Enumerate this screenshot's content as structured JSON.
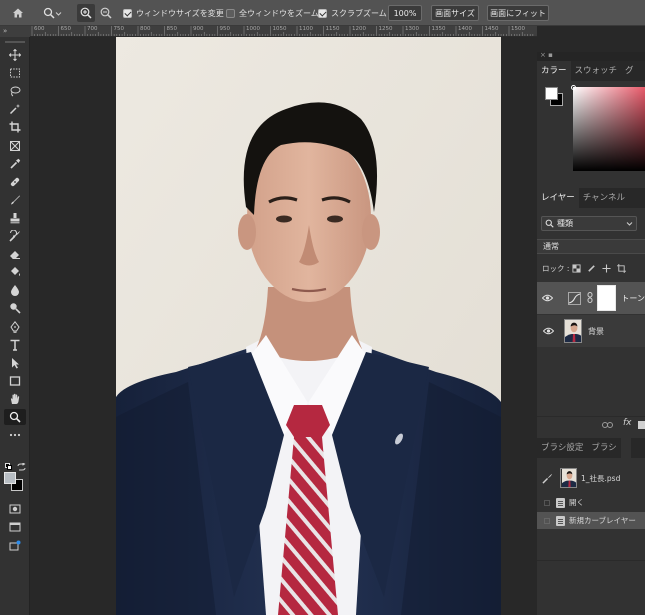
{
  "options_bar": {
    "checkbox_resize_window": {
      "label": "ウィンドウサイズを変更",
      "checked": true
    },
    "checkbox_zoom_all": {
      "label": "全ウィンドウをズーム",
      "checked": false
    },
    "checkbox_scrubby_zoom": {
      "label": "スクラブズーム",
      "checked": true
    },
    "zoom_level": "100%",
    "fit_screen_button": "画面サイズ",
    "fill_screen_button": "画面にフィット"
  },
  "ruler": {
    "corner": "»",
    "ticks": [
      "600",
      "650",
      "700",
      "750",
      "800",
      "850",
      "900",
      "950",
      "1000",
      "1050",
      "1100",
      "1150",
      "1200",
      "1250",
      "1300",
      "1350",
      "1400",
      "1450",
      "1500"
    ]
  },
  "toolbar": {
    "tools": [
      "move-icon",
      "marquee-icon",
      "lasso-icon",
      "magic-wand-icon",
      "crop-icon",
      "frame-icon",
      "eyedropper-icon",
      "healing-brush-icon",
      "brush-icon",
      "stamp-icon",
      "history-brush-icon",
      "eraser-icon",
      "paint-bucket-icon",
      "blur-icon",
      "dodge-icon",
      "pen-icon",
      "type-icon",
      "path-select-icon",
      "rectangle-icon",
      "hand-icon",
      "zoom-icon",
      "more-icon"
    ]
  },
  "panels": {
    "color_tabs": [
      "カラー",
      "スウォッチ",
      "グ"
    ],
    "layers_tabs": [
      "レイヤー",
      "チャンネル"
    ],
    "filter_kind": "種類",
    "blend_mode": "通常",
    "lock_label": "ロック :",
    "layers": [
      {
        "name": "トーン",
        "type": "adjustment"
      },
      {
        "name": "背景",
        "type": "image"
      }
    ],
    "brush_tabs": [
      "ブラシ設定",
      "ブラシ"
    ],
    "history": {
      "snapshot": "1_社長.psd",
      "steps": [
        "開く",
        "新規カーブレイヤー"
      ]
    }
  },
  "colors": {
    "app_bg": "#282828",
    "panel_bg": "#323232",
    "options_bg": "#535353",
    "suit": "#1d2a44",
    "tie_red": "#b52840"
  }
}
